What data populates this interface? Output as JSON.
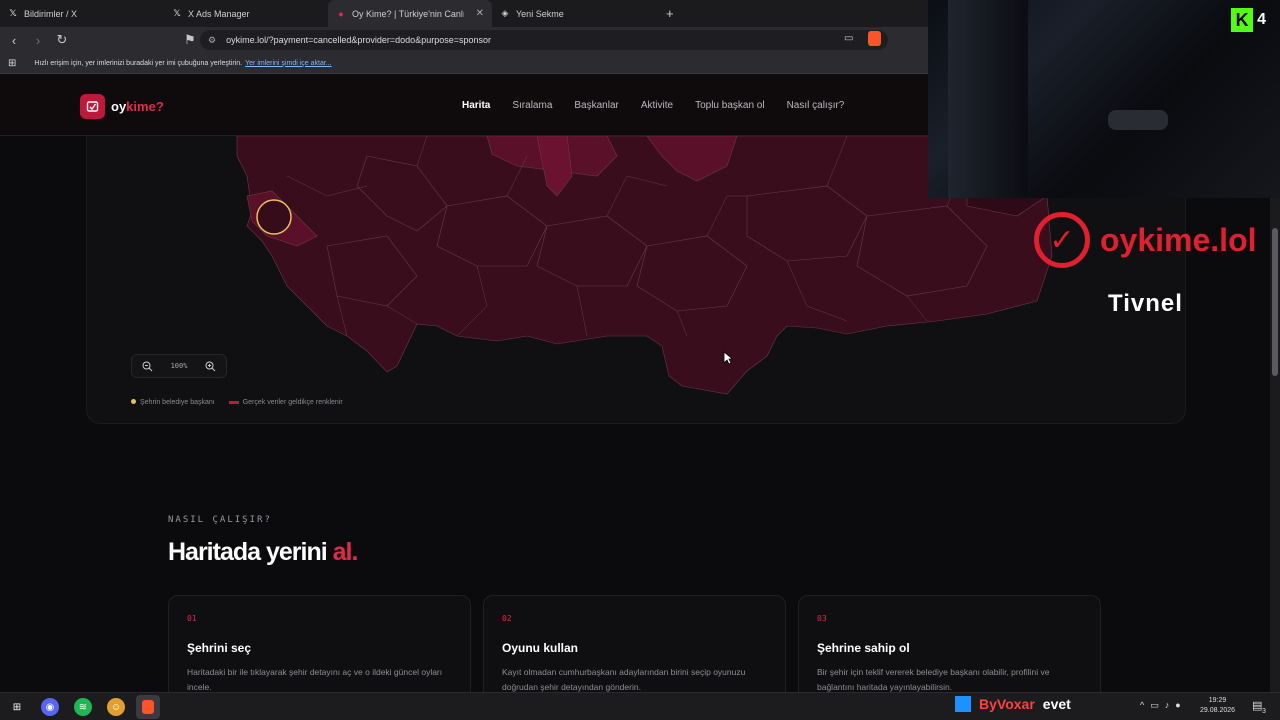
{
  "browser": {
    "tabs": [
      {
        "label": "Bildirimler / X",
        "icon": "x-logo-icon"
      },
      {
        "label": "X Ads Manager",
        "icon": "x-logo-icon"
      },
      {
        "label": "Oy Kime? | Türkiye'nin Canlı Oy Haritası",
        "icon": "oykime-favicon",
        "active": true
      },
      {
        "label": "Yeni Sekme",
        "icon": "brave-shield-icon"
      }
    ],
    "new_tab": "+",
    "url": "oykime.lol/?payment=cancelled&provider=dodo&purpose=sponsor",
    "bookmarks_text": "Hızlı erişim için, yer imlerinizi buradaki yer imi çubuğuna yerleştirin.",
    "bookmarks_link": "Yer imlerini şimdi içe aktar..."
  },
  "site": {
    "logo_main": "oy",
    "logo_sub": "kime",
    "logo_q": "?",
    "nav": [
      "Harita",
      "Sıralama",
      "Başkanlar",
      "Aktivite",
      "Toplu başkan ol",
      "Nasıl çalışır?"
    ],
    "zoom_level": "100%",
    "legend": [
      "Şehrin belediye başkanı",
      "Gerçek veriler geldikçe renklenir"
    ],
    "how": {
      "eyebrow": "NASIL ÇALIŞIR?",
      "headline_main": "Haritada yerini",
      "headline_accent": "al.",
      "cards": [
        {
          "num": "01",
          "title": "Şehrini seç",
          "desc": "Haritadaki bir ile tıklayarak şehir detayını aç ve o ildeki güncel oyları incele."
        },
        {
          "num": "02",
          "title": "Oyunu kullan",
          "desc": "Kayıt olmadan cumhurbaşkanı adaylarından birini seçip oyunuzu doğrudan şehir detayından gönderin."
        },
        {
          "num": "03",
          "title": "Şehrine sahip ol",
          "desc": "Bir şehir için teklif vererek belediye başkanı olabilir, profilini ve bağlantını haritada yayınlayabilirsin."
        }
      ]
    }
  },
  "overlay": {
    "kick_count": "4",
    "brand": "oykime.lol",
    "streamer": "Tivnel",
    "ticker_name": "ByVoxar",
    "ticker_msg": "evet"
  },
  "taskbar": {
    "time": "19:29",
    "date": "29.08.2026",
    "notifications": "3"
  },
  "colors": {
    "accent": "#e02a4d",
    "map_fill": "#3a0d1c",
    "map_highlight": "#5a1028"
  }
}
